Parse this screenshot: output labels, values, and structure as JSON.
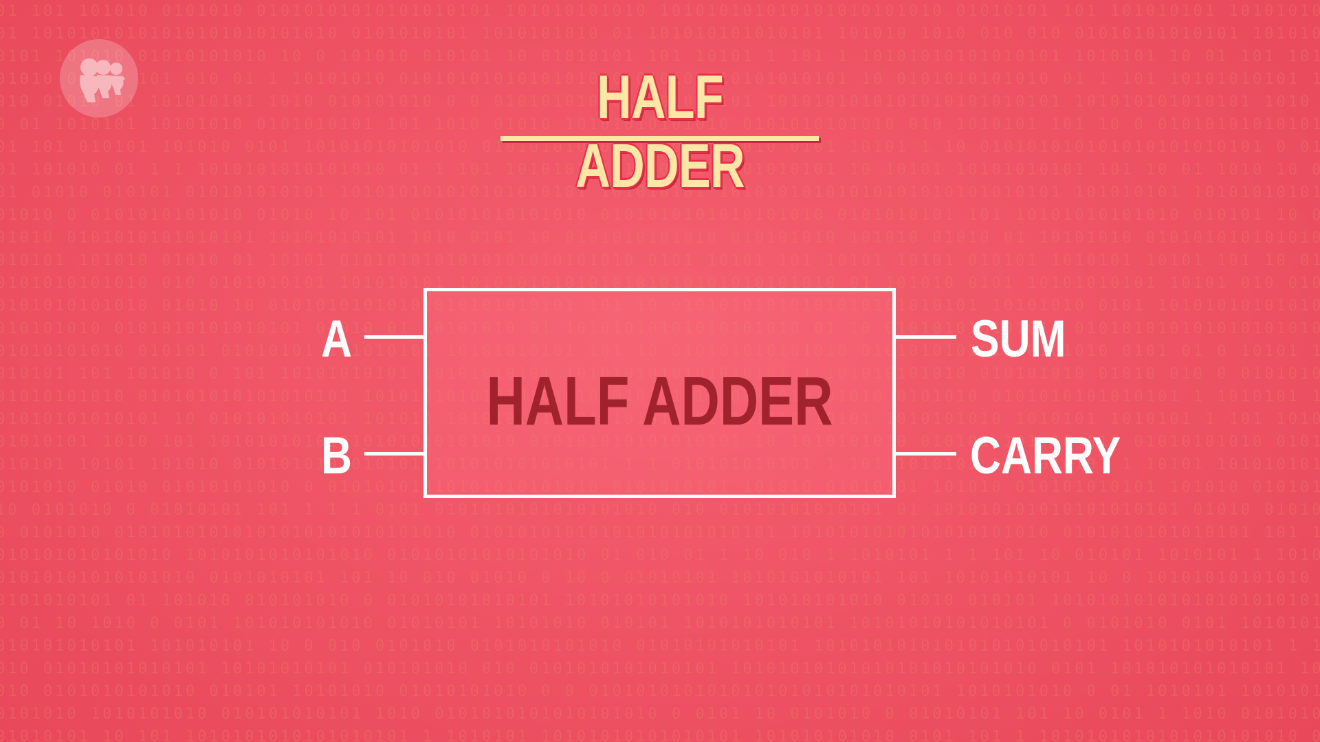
{
  "title": "HALF ADDER",
  "diagram": {
    "block_label": "HALF ADDER",
    "inputs": [
      {
        "label": "A"
      },
      {
        "label": "B"
      }
    ],
    "outputs": [
      {
        "label": "SUM"
      },
      {
        "label": "CARRY"
      }
    ]
  },
  "logo": {
    "icon": "pbs-logo-icon"
  },
  "background": {
    "pattern": "binary-digits"
  },
  "colors": {
    "background": "#ef5566",
    "title_fill": "#fde7a6",
    "block_text": "#a0222c",
    "lines": "#ffffff"
  }
}
